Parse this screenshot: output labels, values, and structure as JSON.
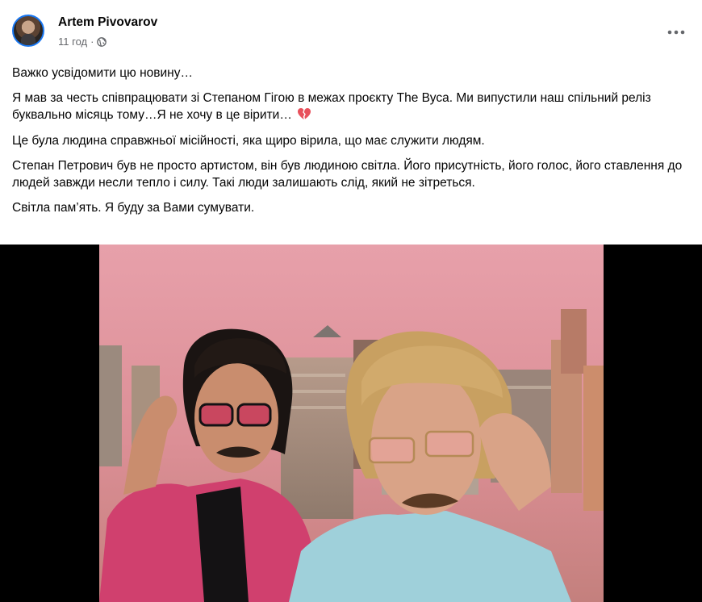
{
  "post": {
    "author": "Artem Pivovarov",
    "time": "11 год",
    "separator": "·",
    "privacy_icon": "globe-icon",
    "more_icon": "more-horizontal-icon",
    "paragraphs": [
      "Важко усвідомити цю новину…",
      "Я мав за честь співпрацювати зі Степаном Гігою в межах проєкту The Вуса. Ми випустили наш спільний реліз буквально місяць тому…Я не хочу в це вірити…",
      "Це була людина справжньої місійності, яка щиро вірила, що має служити людям.",
      "Степан Петрович був не просто артистом, він був людиною світла. Його присутність, його голос, його ставлення до людей завжди несли тепло і силу. Такі люди залишають слід, який не зітреться.",
      "Світла пам’ять. Я буду за Вами сумувати."
    ],
    "emoji_icon": "broken-heart-icon"
  },
  "colors": {
    "accent": "#1877f2",
    "secondary_text": "#65676b",
    "broken_heart": "#e8505b"
  }
}
